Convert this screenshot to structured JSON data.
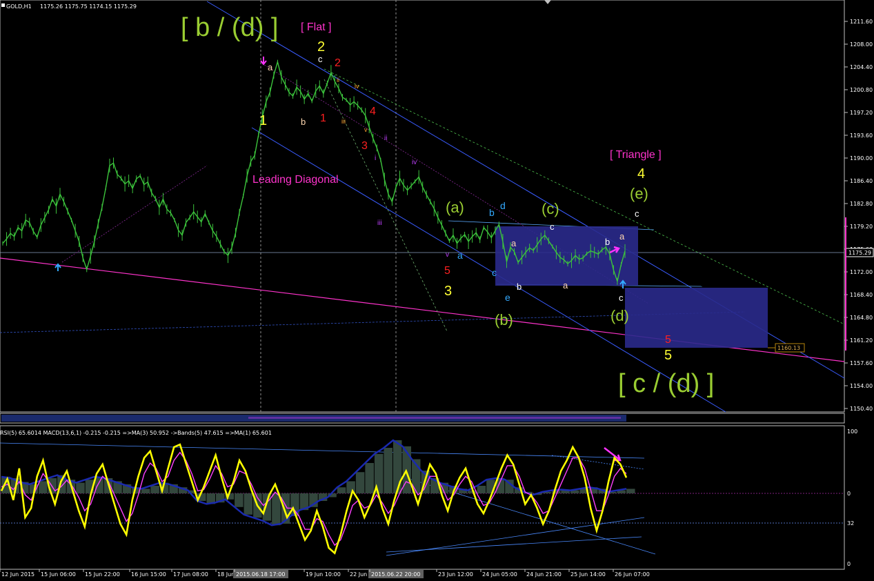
{
  "chart_data": [
    {
      "type": "line",
      "header": {
        "symbol": "GOLD,H1",
        "ohlc": "1175.26 1175.75 1174.15 1175.29"
      },
      "y_axis": {
        "range": [
          1149.0,
          1213.0
        ],
        "ticks": [
          "1211.60",
          "1208.00",
          "1204.40",
          "1200.80",
          "1197.20",
          "1193.60",
          "1190.00",
          "1186.40",
          "1182.80",
          "1179.20",
          "1175.60",
          "1172.00",
          "1168.40",
          "1164.80",
          "1161.20",
          "1157.60",
          "1154.00",
          "1150.40"
        ],
        "current_price": "1175.29",
        "target_price": "1160.13"
      },
      "x_axis": {
        "ticks": [
          "12 Jun 2015",
          "15 Jun 06:00",
          "15 Jun 22:00",
          "16 Jun 15:00",
          "17 Jun 08:00",
          "18 Jun",
          "2015.06.18 17:00",
          "19 Jun 10:00",
          "22 Jun",
          "2015.06.22 20:00",
          "23 Jun 12:00",
          "24 Jun 05:00",
          "24 Jun 21:00",
          "25 Jun 14:00",
          "26 Jun 07:00"
        ]
      },
      "series": [
        {
          "name": "GOLD",
          "color": "#3cc43c",
          "values": [
            1176.5,
            1177.2,
            1178.1,
            1177.6,
            1179.0,
            1178.5,
            1180.2,
            1179.8,
            1178.4,
            1177.5,
            1179.4,
            1180.6,
            1181.8,
            1183.5,
            1182.4,
            1184.3,
            1183.1,
            1181.6,
            1180.2,
            1178.5,
            1176.8,
            1174.2,
            1172.4,
            1174.5,
            1176.8,
            1179.6,
            1182.2,
            1185.3,
            1188.8,
            1189.2,
            1187.4,
            1186.8,
            1185.9,
            1186.4,
            1185.2,
            1186.7,
            1187.2,
            1185.8,
            1186.2,
            1184.5,
            1183.6,
            1182.2,
            1183.5,
            1181.9,
            1181.3,
            1180.2,
            1178.6,
            1177.8,
            1179.8,
            1180.6,
            1181.5,
            1180.7,
            1179.9,
            1181.2,
            1179.8,
            1178.5,
            1177.6,
            1176.4,
            1175.2,
            1174.6,
            1175.8,
            1178.2,
            1181.4,
            1184.0,
            1187.2,
            1189.5,
            1190.4,
            1193.7,
            1196.5,
            1198.9,
            1200.4,
            1203.1,
            1205.2,
            1202.8,
            1201.6,
            1200.4,
            1199.8,
            1201.2,
            1200.5,
            1199.3,
            1200.2,
            1199.0,
            1200.6,
            1201.4,
            1200.2,
            1201.8,
            1203.5,
            1202.1,
            1201.0,
            1199.6,
            1199.2,
            1198.4,
            1198.9,
            1198.3,
            1197.6,
            1196.7,
            1194.9,
            1193.1,
            1191.6,
            1189.7,
            1186.6,
            1184.3,
            1183.1,
            1185.4,
            1186.8,
            1185.7,
            1184.9,
            1185.6,
            1186.3,
            1187.0,
            1185.4,
            1184.2,
            1183.1,
            1182.0,
            1180.6,
            1179.4,
            1178.1,
            1176.9,
            1177.8,
            1176.5,
            1177.3,
            1177.9,
            1176.8,
            1177.6,
            1178.2,
            1177.1,
            1179.0,
            1178.3,
            1177.4,
            1178.5,
            1179.5,
            1176.8,
            1173.6,
            1175.9,
            1175.2,
            1173.5,
            1174.3,
            1175.1,
            1175.8,
            1175.4,
            1176.3,
            1177.2,
            1177.8,
            1176.9,
            1176.0,
            1175.1,
            1174.3,
            1173.9,
            1173.3,
            1173.8,
            1174.6,
            1174.0,
            1174.2,
            1174.9,
            1175.3,
            1175.1,
            1174.8,
            1175.5,
            1175.9,
            1174.8,
            1172.3,
            1170.5,
            1173.2,
            1175.29
          ]
        }
      ],
      "annotations": {
        "title_wave": "[ b / (d) ]",
        "flat": "[ Flat ]",
        "triangle": "[ Triangle ]",
        "target_wave": "[ c / (d) ]",
        "leading_diagonal": "Leading Diagonal",
        "wave_labels": [
          "1",
          "2",
          "3",
          "4",
          "5",
          "a",
          "b",
          "c",
          "d",
          "e",
          "(a)",
          "(b)",
          "(c)",
          "(d)",
          "(e)",
          "i",
          "ii",
          "iii",
          "iv",
          "v"
        ]
      }
    },
    {
      "type": "line",
      "header": "RSI(5) 65.6014  MACD(13,6,1) -0.215 -0.215  =>MA(3) 50.952  ->Bands(5) 47.615  =>MA(1) 65.601",
      "y_axis": {
        "range": [
          0,
          100
        ],
        "ticks": [
          "100",
          "0",
          "32",
          "0"
        ]
      },
      "series": [
        {
          "name": "RSI(5)",
          "color": "#ffff00",
          "values": [
            55,
            64,
            48,
            72,
            35,
            42,
            66,
            78,
            58,
            45,
            62,
            70,
            55,
            40,
            28,
            52,
            68,
            75,
            60,
            45,
            30,
            22,
            48,
            66,
            80,
            85,
            70,
            55,
            72,
            88,
            90,
            76,
            62,
            48,
            58,
            70,
            82,
            65,
            50,
            62,
            78,
            70,
            56,
            44,
            38,
            52,
            60,
            48,
            35,
            42,
            30,
            18,
            25,
            40,
            28,
            12,
            8,
            22,
            40,
            55,
            48,
            35,
            45,
            58,
            42,
            30,
            48,
            62,
            70,
            58,
            45,
            60,
            75,
            68,
            52,
            40,
            55,
            65,
            72,
            58,
            45,
            38,
            48,
            60,
            72,
            82,
            75,
            60,
            45,
            52,
            42,
            30,
            40,
            56,
            70,
            78,
            88,
            80,
            65,
            42,
            25,
            40,
            62,
            80,
            75,
            65
          ]
        },
        {
          "name": "MA",
          "color": "#ff40ff",
          "values": [
            58,
            60,
            56,
            62,
            52,
            48,
            58,
            68,
            62,
            55,
            58,
            63,
            58,
            50,
            40,
            45,
            58,
            66,
            62,
            52,
            42,
            32,
            38,
            52,
            68,
            76,
            72,
            62,
            66,
            78,
            84,
            78,
            68,
            55,
            56,
            64,
            74,
            68,
            58,
            60,
            70,
            68,
            60,
            50,
            44,
            48,
            54,
            50,
            42,
            42,
            36,
            26,
            26,
            34,
            32,
            22,
            14,
            18,
            30,
            44,
            48,
            42,
            44,
            52,
            46,
            38,
            44,
            54,
            62,
            60,
            52,
            56,
            66,
            66,
            58,
            48,
            52,
            60,
            66,
            62,
            52,
            44,
            46,
            54,
            64,
            74,
            74,
            66,
            54,
            52,
            46,
            38,
            40,
            50,
            60,
            70,
            80,
            80,
            72,
            56,
            40,
            40,
            52,
            66,
            72,
            68
          ]
        },
        {
          "name": "MACD",
          "color": "#33473d",
          "type": "histogram",
          "values": [
            22,
            20,
            15,
            12,
            16,
            20,
            24,
            18,
            14,
            18,
            22,
            20,
            16,
            12,
            8,
            6,
            10,
            14,
            12,
            8,
            4,
            -10,
            -14,
            -12,
            -8,
            -18,
            -28,
            -32,
            -36,
            -42,
            -40,
            -30,
            -22,
            -18,
            -10,
            -5,
            8,
            16,
            28,
            40,
            52,
            60,
            70,
            62,
            45,
            30,
            20,
            14,
            10,
            6,
            4,
            10,
            18,
            20,
            18,
            8,
            2,
            -2,
            2,
            4,
            5,
            4,
            6,
            8,
            6,
            2,
            4,
            6
          ]
        }
      ]
    }
  ],
  "colors": {
    "background": "#000000",
    "candles": "#3cc43c",
    "channel": "#4060ff",
    "zone": "#2a2a8c",
    "magenta_line": "#ff33cc",
    "wave_yellow": "#ffff33",
    "wave_green": "#9acd32",
    "wave_red": "#ff2020",
    "wave_cyan": "#33aaff",
    "wave_peach": "#ffd7b0",
    "rsi": "#ffff00",
    "rsi_ma": "#ff40ff",
    "macd": "#33473d"
  }
}
